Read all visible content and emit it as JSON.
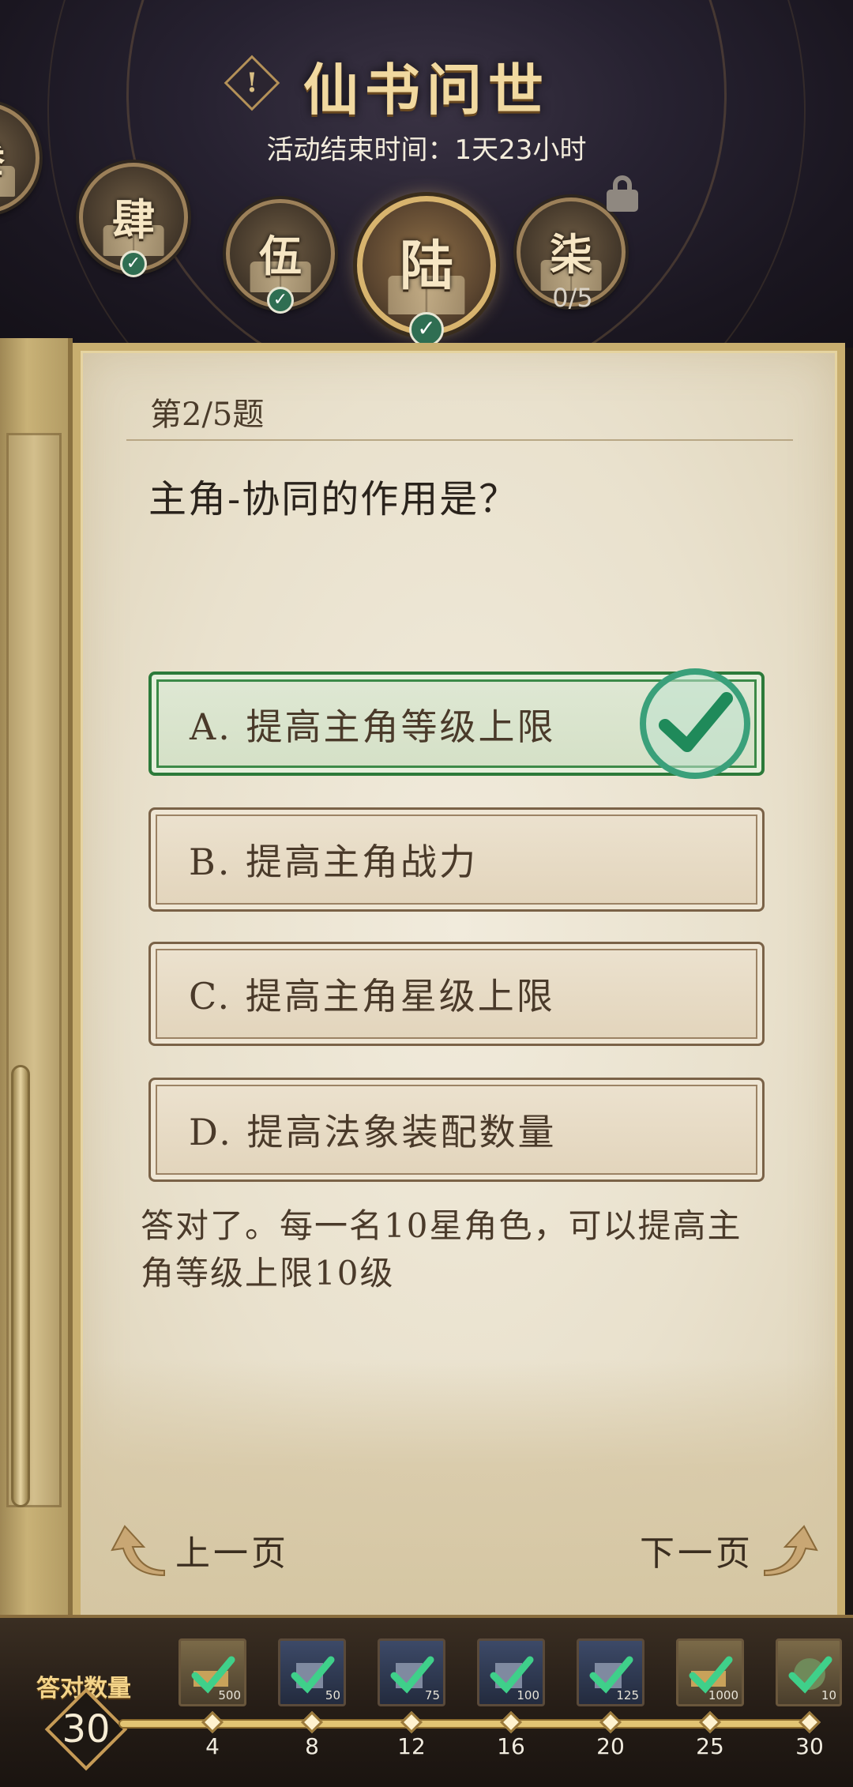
{
  "header": {
    "title": "仙书问世",
    "subtitle": "活动结束时间：1天23小时",
    "info_icon_text": "!"
  },
  "chapters": [
    {
      "label": "叁",
      "completed": true
    },
    {
      "label": "肆",
      "completed": true
    },
    {
      "label": "伍",
      "completed": true
    },
    {
      "label": "陆",
      "completed": true,
      "active": true
    },
    {
      "label": "柒",
      "locked": true,
      "progress": "0/5"
    }
  ],
  "quiz": {
    "question_number": "第2/5题",
    "question": "主角-协同的作用是？",
    "options": [
      {
        "label": "A. 提高主角等级上限",
        "state": "correct"
      },
      {
        "label": "B. 提高主角战力",
        "state": "default"
      },
      {
        "label": "C. 提高主角星级上限",
        "state": "default"
      },
      {
        "label": "D. 提高法象装配数量",
        "state": "default"
      }
    ],
    "explanation": "答对了。每一名10星角色，可以提高主角等级上限10级",
    "prev_label": "上一页",
    "next_label": "下一页"
  },
  "rewards_bar": {
    "count_label": "答对数量",
    "count_value": "30",
    "milestones": [
      "4",
      "8",
      "12",
      "16",
      "20",
      "25",
      "30"
    ],
    "rewards": [
      {
        "amount": "500",
        "kind": "gold"
      },
      {
        "amount": "50",
        "kind": "blue"
      },
      {
        "amount": "75",
        "kind": "blue"
      },
      {
        "amount": "100",
        "kind": "blue"
      },
      {
        "amount": "125",
        "kind": "blue"
      },
      {
        "amount": "1000",
        "kind": "gold"
      },
      {
        "amount": "10",
        "kind": "jade"
      }
    ]
  },
  "colors": {
    "correct_green": "#2c7a3a",
    "gold_accent": "#c8ae6f",
    "paper": "#efe8d8"
  }
}
